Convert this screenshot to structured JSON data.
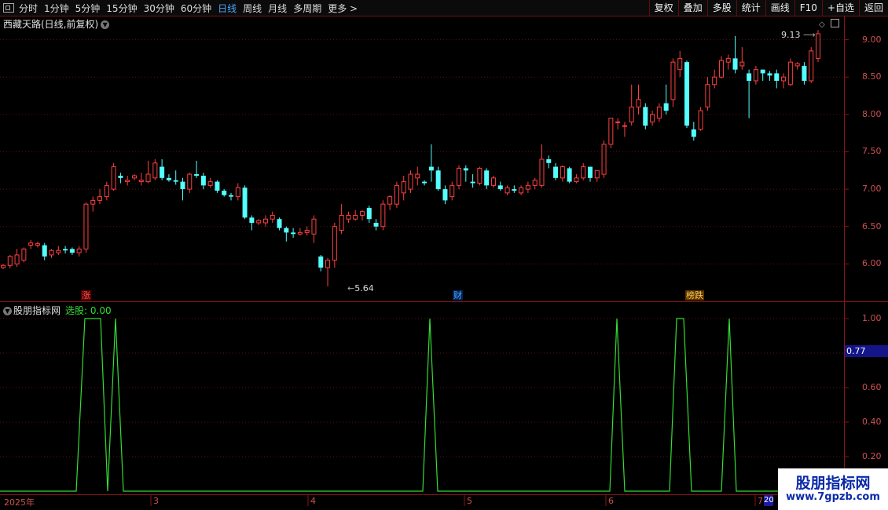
{
  "toolbar": {
    "periods": [
      {
        "label": "分时",
        "active": false
      },
      {
        "label": "1分钟",
        "active": false
      },
      {
        "label": "5分钟",
        "active": false
      },
      {
        "label": "15分钟",
        "active": false
      },
      {
        "label": "30分钟",
        "active": false
      },
      {
        "label": "60分钟",
        "active": false
      },
      {
        "label": "日线",
        "active": true
      },
      {
        "label": "周线",
        "active": false
      },
      {
        "label": "月线",
        "active": false
      },
      {
        "label": "多周期",
        "active": false
      },
      {
        "label": "更多 >",
        "active": false
      }
    ],
    "tools": [
      "复权",
      "叠加",
      "多股",
      "统计",
      "画线",
      "F10",
      "+自选",
      "返回"
    ]
  },
  "main_panel": {
    "title": "西藏天路(日线,前复权)",
    "high_label": "9.13",
    "low_label": "5.64",
    "events": [
      {
        "label": "涨",
        "color": "#ff5555",
        "bg": "#550000"
      },
      {
        "label": "财",
        "color": "#55aaff",
        "bg": "#002255"
      },
      {
        "label": "榜跌",
        "color": "#ffcc55",
        "bg": "#553300"
      }
    ],
    "y_ticks": [
      "9.00",
      "8.50",
      "8.00",
      "7.50",
      "7.00",
      "6.50",
      "6.00"
    ]
  },
  "indicator_panel": {
    "name": "股朋指标网",
    "value_label": "选股: 0.00",
    "y_ticks": [
      "1.00",
      "0.80",
      "0.60",
      "0.40",
      "0.20"
    ],
    "cursor_value": "0.77"
  },
  "x_axis": {
    "labels": [
      "2025年",
      "3",
      "4",
      "5",
      "6",
      "7"
    ],
    "tag": "20"
  },
  "watermark": {
    "title": "股朋指标网",
    "url": "www.7gpzb.com"
  },
  "colors": {
    "up": "#ff4040",
    "down": "#54ffff",
    "signal": "#33dd33",
    "axis": "#8a1515"
  },
  "chart_data": {
    "type": "candlestick",
    "price_range": [
      5.5,
      9.3
    ],
    "candles": [
      [
        5.95,
        5.98,
        5.93,
        6.0
      ],
      [
        5.98,
        6.1,
        5.94,
        6.12
      ],
      [
        6.0,
        6.12,
        5.96,
        6.2
      ],
      [
        6.05,
        6.2,
        6.02,
        6.22
      ],
      [
        6.25,
        6.28,
        6.2,
        6.32
      ],
      [
        6.25,
        6.27,
        6.22,
        6.3
      ],
      [
        6.25,
        6.1,
        6.05,
        6.28
      ],
      [
        6.12,
        6.18,
        6.08,
        6.2
      ],
      [
        6.15,
        6.18,
        6.12,
        6.24
      ],
      [
        6.2,
        6.18,
        6.14,
        6.24
      ],
      [
        6.2,
        6.15,
        6.12,
        6.22
      ],
      [
        6.15,
        6.2,
        6.1,
        6.24
      ],
      [
        6.2,
        6.8,
        6.15,
        6.82
      ],
      [
        6.8,
        6.85,
        6.7,
        6.9
      ],
      [
        6.85,
        6.9,
        6.8,
        7.0
      ],
      [
        6.9,
        7.05,
        6.85,
        7.1
      ],
      [
        7.0,
        7.3,
        6.98,
        7.35
      ],
      [
        7.18,
        7.15,
        7.08,
        7.22
      ],
      [
        7.1,
        7.12,
        7.05,
        7.18
      ],
      [
        7.15,
        7.18,
        7.12,
        7.2
      ],
      [
        7.1,
        7.12,
        7.05,
        7.22
      ],
      [
        7.1,
        7.2,
        7.08,
        7.38
      ],
      [
        7.15,
        7.35,
        7.12,
        7.4
      ],
      [
        7.3,
        7.15,
        7.12,
        7.4
      ],
      [
        7.15,
        7.12,
        7.1,
        7.2
      ],
      [
        7.12,
        7.1,
        7.06,
        7.25
      ],
      [
        7.1,
        7.0,
        6.85,
        7.15
      ],
      [
        7.0,
        7.2,
        6.95,
        7.22
      ],
      [
        7.2,
        7.18,
        7.15,
        7.38
      ],
      [
        7.18,
        7.05,
        7.0,
        7.22
      ],
      [
        7.05,
        7.1,
        7.02,
        7.15
      ],
      [
        7.1,
        6.98,
        6.95,
        7.12
      ],
      [
        6.98,
        6.92,
        6.9,
        7.0
      ],
      [
        6.92,
        6.9,
        6.85,
        6.95
      ],
      [
        6.9,
        7.02,
        6.85,
        7.08
      ],
      [
        7.02,
        6.62,
        6.6,
        7.05
      ],
      [
        6.62,
        6.55,
        6.45,
        6.65
      ],
      [
        6.55,
        6.58,
        6.52,
        6.6
      ],
      [
        6.55,
        6.6,
        6.5,
        6.65
      ],
      [
        6.6,
        6.65,
        6.55,
        6.7
      ],
      [
        6.6,
        6.48,
        6.45,
        6.62
      ],
      [
        6.48,
        6.42,
        6.3,
        6.5
      ],
      [
        6.42,
        6.4,
        6.35,
        6.48
      ],
      [
        6.4,
        6.42,
        6.38,
        6.48
      ],
      [
        6.42,
        6.45,
        6.38,
        6.5
      ],
      [
        6.4,
        6.6,
        6.28,
        6.65
      ],
      [
        6.1,
        5.95,
        5.9,
        6.12
      ],
      [
        5.95,
        6.05,
        5.7,
        6.08
      ],
      [
        6.05,
        6.5,
        5.95,
        6.55
      ],
      [
        6.45,
        6.65,
        6.4,
        6.8
      ],
      [
        6.6,
        6.65,
        6.55,
        6.7
      ],
      [
        6.6,
        6.65,
        6.58,
        6.72
      ],
      [
        6.65,
        6.7,
        6.58,
        6.72
      ],
      [
        6.75,
        6.6,
        6.55,
        6.78
      ],
      [
        6.55,
        6.5,
        6.45,
        6.6
      ],
      [
        6.5,
        6.8,
        6.45,
        6.85
      ],
      [
        6.8,
        6.9,
        6.72,
        6.92
      ],
      [
        6.8,
        7.05,
        6.75,
        7.1
      ],
      [
        6.95,
        7.1,
        6.85,
        7.18
      ],
      [
        7.0,
        7.2,
        6.95,
        7.25
      ],
      [
        7.15,
        7.2,
        7.05,
        7.3
      ],
      [
        7.1,
        7.08,
        7.05,
        7.12
      ],
      [
        7.3,
        7.25,
        7.1,
        7.6
      ],
      [
        7.25,
        7.0,
        6.98,
        7.3
      ],
      [
        7.0,
        6.85,
        6.8,
        7.05
      ],
      [
        6.9,
        7.05,
        6.85,
        7.1
      ],
      [
        7.05,
        7.28,
        7.0,
        7.32
      ],
      [
        7.28,
        7.25,
        7.1,
        7.32
      ],
      [
        7.1,
        7.08,
        7.02,
        7.2
      ],
      [
        7.08,
        7.28,
        7.05,
        7.3
      ],
      [
        7.25,
        7.05,
        7.0,
        7.28
      ],
      [
        7.05,
        7.15,
        7.02,
        7.18
      ],
      [
        7.05,
        7.0,
        6.98,
        7.1
      ],
      [
        6.95,
        7.02,
        6.92,
        7.05
      ],
      [
        7.0,
        6.98,
        6.95,
        7.05
      ],
      [
        6.95,
        7.02,
        6.92,
        7.05
      ],
      [
        7.0,
        7.05,
        6.95,
        7.1
      ],
      [
        7.05,
        7.12,
        7.0,
        7.15
      ],
      [
        7.05,
        7.4,
        7.02,
        7.6
      ],
      [
        7.4,
        7.35,
        7.28,
        7.45
      ],
      [
        7.3,
        7.15,
        7.12,
        7.35
      ],
      [
        7.15,
        7.3,
        7.1,
        7.32
      ],
      [
        7.28,
        7.1,
        7.08,
        7.3
      ],
      [
        7.1,
        7.15,
        7.08,
        7.2
      ],
      [
        7.15,
        7.3,
        7.12,
        7.35
      ],
      [
        7.3,
        7.15,
        7.1,
        7.3
      ],
      [
        7.15,
        7.25,
        7.1,
        7.25
      ],
      [
        7.2,
        7.6,
        7.15,
        7.65
      ],
      [
        7.6,
        7.95,
        7.55,
        7.95
      ],
      [
        7.9,
        7.9,
        7.8,
        7.95
      ],
      [
        7.85,
        7.85,
        7.7,
        7.9
      ],
      [
        7.9,
        8.1,
        7.85,
        8.4
      ],
      [
        8.1,
        8.2,
        8.0,
        8.4
      ],
      [
        8.1,
        7.85,
        7.8,
        8.15
      ],
      [
        7.9,
        8.0,
        7.85,
        8.05
      ],
      [
        7.95,
        8.1,
        7.9,
        8.15
      ],
      [
        8.15,
        8.05,
        8.0,
        8.4
      ],
      [
        8.2,
        8.7,
        8.1,
        8.75
      ],
      [
        8.6,
        8.75,
        8.5,
        8.85
      ],
      [
        8.7,
        7.85,
        7.82,
        8.72
      ],
      [
        7.8,
        7.7,
        7.65,
        7.9
      ],
      [
        7.8,
        8.05,
        7.78,
        8.1
      ],
      [
        8.1,
        8.4,
        8.05,
        8.5
      ],
      [
        8.4,
        8.5,
        8.35,
        8.6
      ],
      [
        8.5,
        8.72,
        8.48,
        8.78
      ],
      [
        8.7,
        8.75,
        8.6,
        8.8
      ],
      [
        8.75,
        8.6,
        8.55,
        9.05
      ],
      [
        8.65,
        8.7,
        8.6,
        8.9
      ],
      [
        8.55,
        8.45,
        7.95,
        8.6
      ],
      [
        8.45,
        8.6,
        8.4,
        8.65
      ],
      [
        8.6,
        8.55,
        8.45,
        8.6
      ],
      [
        8.55,
        8.52,
        8.45,
        8.58
      ],
      [
        8.55,
        8.45,
        8.35,
        8.6
      ],
      [
        8.45,
        8.5,
        8.35,
        8.55
      ],
      [
        8.4,
        8.7,
        8.38,
        8.75
      ],
      [
        8.65,
        8.68,
        8.6,
        8.7
      ],
      [
        8.65,
        8.45,
        8.4,
        8.7
      ],
      [
        8.45,
        8.85,
        8.42,
        8.9
      ],
      [
        8.75,
        9.08,
        8.7,
        9.13
      ]
    ],
    "signal": [
      [
        0,
        0
      ],
      [
        97,
        0
      ],
      [
        108,
        1
      ],
      [
        128,
        1
      ],
      [
        137,
        0
      ],
      [
        147,
        1
      ],
      [
        157,
        0
      ],
      [
        538,
        0
      ],
      [
        547,
        1
      ],
      [
        557,
        0
      ],
      [
        776,
        0
      ],
      [
        785,
        1
      ],
      [
        795,
        0
      ],
      [
        852,
        0
      ],
      [
        861,
        1
      ],
      [
        870,
        1
      ],
      [
        880,
        0
      ],
      [
        918,
        0
      ],
      [
        928,
        1
      ],
      [
        937,
        0
      ],
      [
        1074,
        0
      ]
    ]
  }
}
